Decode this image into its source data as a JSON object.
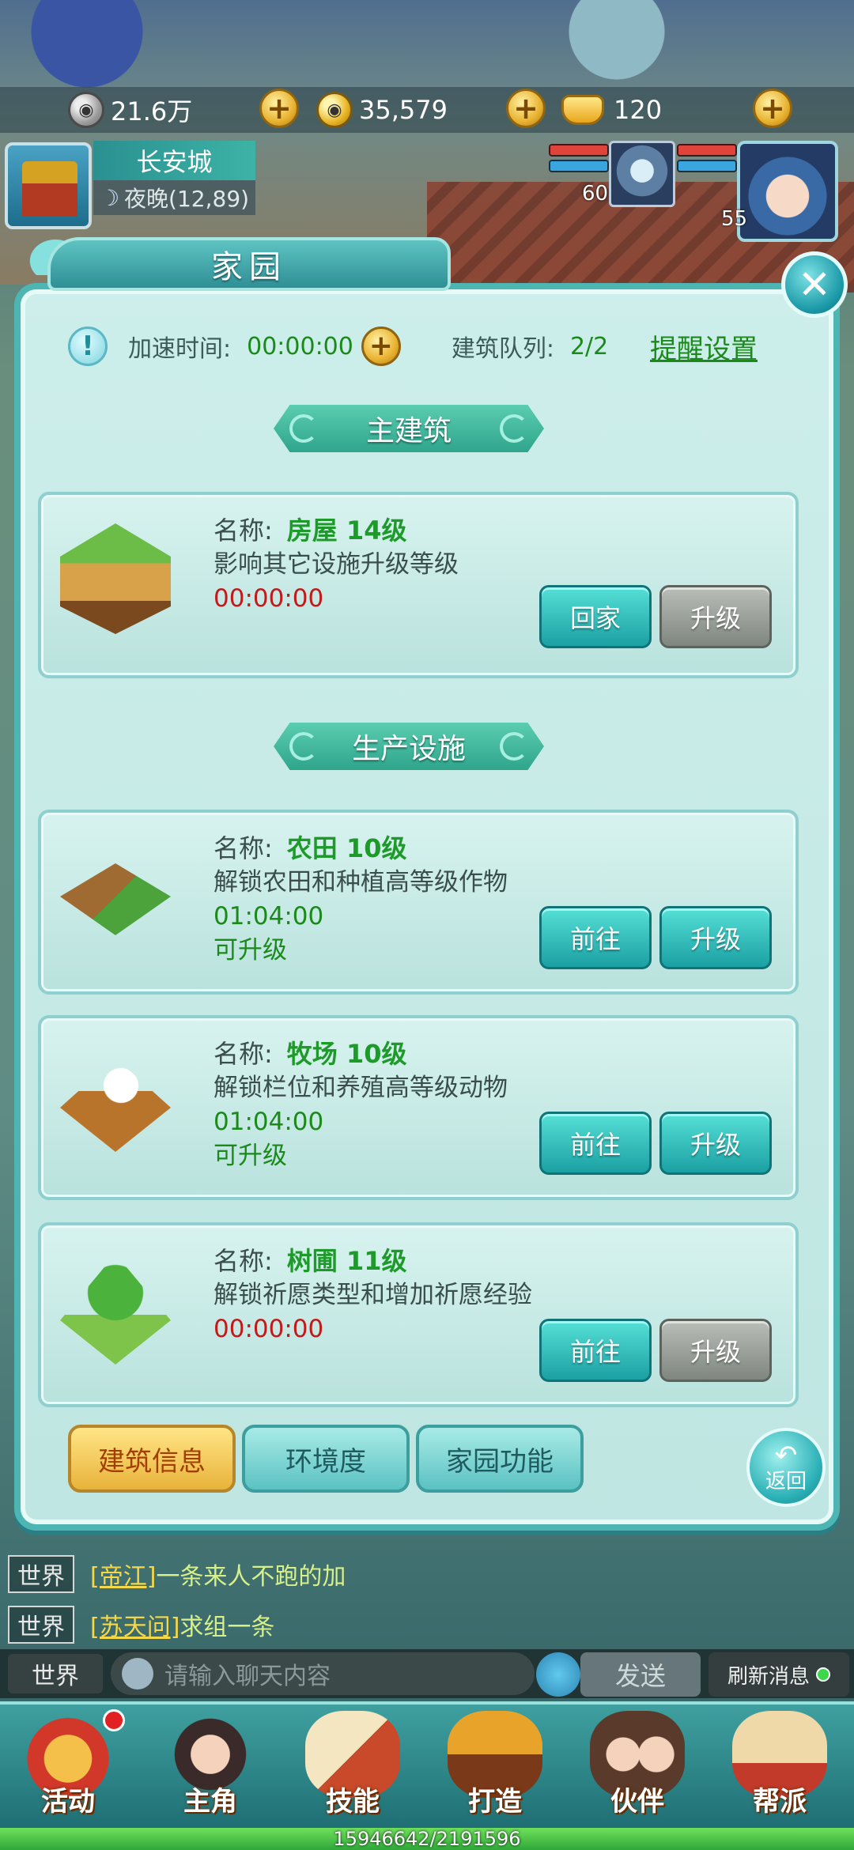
{
  "resources": {
    "silver": "21.6万",
    "coins": "35,579",
    "ingots": "120"
  },
  "location": {
    "city": "长安城",
    "time_coords": "夜晚(12,89)"
  },
  "party": {
    "pet_level": "60",
    "hero_level": "55"
  },
  "dialog": {
    "title": "家园",
    "speed_label": "加速时间:",
    "speed_value": "00:00:00",
    "queue_label": "建筑队列:",
    "queue_value": "2/2",
    "remind_link": "提醒设置",
    "section_main": "主建筑",
    "section_production": "生产设施",
    "name_prefix": "名称:",
    "buildings": [
      {
        "name": "房屋 14级",
        "desc": "影响其它设施升级等级",
        "timer": "00:00:00",
        "status": "",
        "btn_left": "回家",
        "btn_right": "升级",
        "upgrade_enabled": false
      },
      {
        "name": "农田 10级",
        "desc": "解锁农田和种植高等级作物",
        "timer": "01:04:00",
        "status": "可升级",
        "btn_left": "前往",
        "btn_right": "升级",
        "upgrade_enabled": true
      },
      {
        "name": "牧场 10级",
        "desc": "解锁栏位和养殖高等级动物",
        "timer": "01:04:00",
        "status": "可升级",
        "btn_left": "前往",
        "btn_right": "升级",
        "upgrade_enabled": true
      },
      {
        "name": "树圃 11级",
        "desc": "解锁祈愿类型和增加祈愿经验",
        "timer": "00:00:00",
        "status": "",
        "btn_left": "前往",
        "btn_right": "升级",
        "upgrade_enabled": false
      }
    ],
    "tabs": [
      "建筑信息",
      "环境度",
      "家园功能"
    ],
    "back_label": "返回"
  },
  "chat": {
    "messages": [
      {
        "channel": "世界",
        "user": "[帝江]",
        "text": "一条来人不跑的加"
      },
      {
        "channel": "世界",
        "user": "[苏天问]",
        "text": "求组一条"
      }
    ],
    "channel_label": "世界",
    "input_placeholder": "请输入聊天内容",
    "send_label": "发送",
    "refresh_label": "刷新消息"
  },
  "nav": [
    {
      "label": "活动",
      "has_notification": true
    },
    {
      "label": "主角",
      "has_notification": false
    },
    {
      "label": "技能",
      "has_notification": false
    },
    {
      "label": "打造",
      "has_notification": false
    },
    {
      "label": "伙伴",
      "has_notification": false
    },
    {
      "label": "帮派",
      "has_notification": false
    }
  ],
  "xp": {
    "text": "15946642/2191596",
    "progress": 1.0
  }
}
